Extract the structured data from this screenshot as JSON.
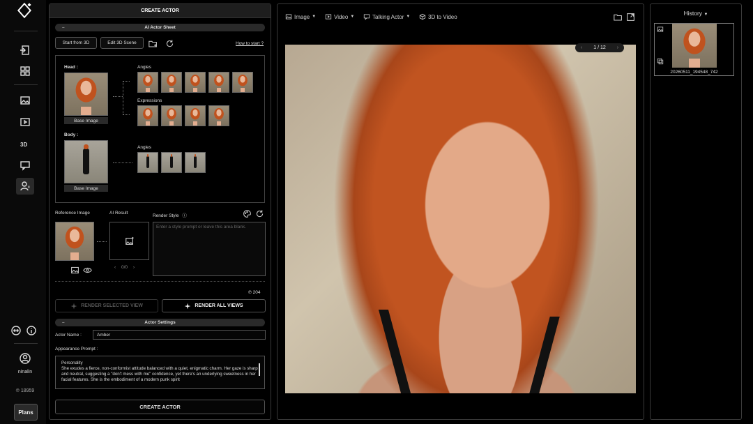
{
  "rail": {
    "credits": "18959",
    "user_name": "ninalin",
    "plans_label": "Plans"
  },
  "create": {
    "title": "CREATE ACTOR",
    "sheet_section": "AI Actor Sheet",
    "start_3d": "Start from 3D",
    "edit_3d": "Edit 3D Scene",
    "how_to": "How to start ?",
    "head_label": "Head :",
    "body_label": "Body :",
    "angles_label": "Angles",
    "expressions_label": "Expressions",
    "base_image": "Base Image",
    "reference_label": "Reference Image",
    "ai_result_label": "AI Result",
    "render_style_label": "Render Style",
    "style_placeholder": "Enter a style prompt or leave this area blank.",
    "result_count": "0/0",
    "cost": "204",
    "render_selected": "RENDER SELECTED VIEW",
    "render_all": "RENDER ALL VIEWS",
    "settings_section": "Actor Settings",
    "actor_name_label": "Actor Name :",
    "actor_name_value": "Amber",
    "appearance_label": "Appearance Prompt :",
    "appearance_heading": "Personality",
    "appearance_text": "She exudes a fierce, non-conformist attitude balanced with a quiet, enigmatic charm. Her gaze is sharp and neutral, suggesting a \"don't mess with me\" confidence, yet there's an underlying sweetness in her facial features. She is the embodiment of a modern punk spirit",
    "create_button": "CREATE ACTOR"
  },
  "viewer": {
    "tools": [
      "Image",
      "Video",
      "Talking Actor",
      "3D to Video"
    ],
    "pager": "1 / 12"
  },
  "history": {
    "title": "History",
    "item_label": "20260511_194548_742"
  }
}
